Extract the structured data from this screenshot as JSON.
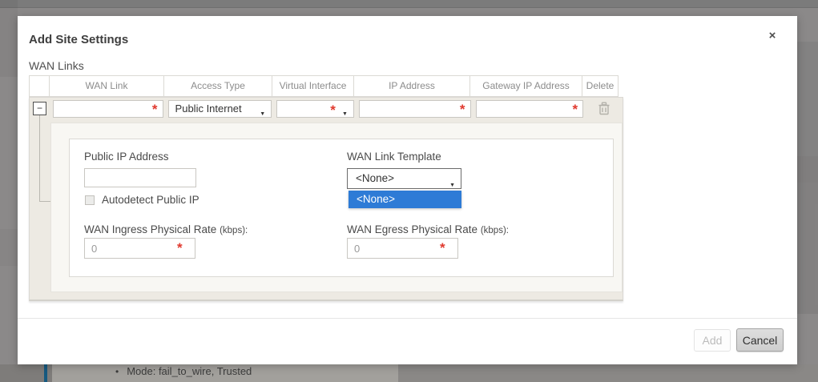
{
  "modal": {
    "title": "Add Site Settings",
    "section_label": "WAN Links",
    "table": {
      "headers": [
        "",
        "WAN Link",
        "Access Type",
        "Virtual Interface",
        "IP Address",
        "Gateway IP Address",
        "Delete"
      ],
      "row": {
        "wan_link_value": "",
        "access_type_value": "Public Internet",
        "virtual_interface_value": "",
        "ip_address_value": "",
        "gateway_ip_value": ""
      }
    },
    "detail_panel": {
      "public_ip_label": "Public IP Address",
      "public_ip_value": "",
      "autodetect_label": "Autodetect Public IP",
      "autodetect_checked": false,
      "template_label": "WAN Link Template",
      "template_selected_value": "<None>",
      "template_open_option": "<None>",
      "ingress_label": "WAN Ingress Physical Rate",
      "ingress_unit": "(kbps):",
      "ingress_value": "0",
      "egress_label": "WAN Egress Physical Rate",
      "egress_unit": "(kbps):",
      "egress_value": "0"
    },
    "footer": {
      "add_label": "Add",
      "cancel_label": "Cancel"
    }
  },
  "background": {
    "mode_text": "Mode: fail_to_wire, Trusted"
  },
  "icons": {
    "close": "×",
    "collapse_minus": "−",
    "caret_down": "▼",
    "required_marker": "*",
    "bullet": "•"
  },
  "colors": {
    "required_red": "#e0392e",
    "option_highlight_blue": "#2e7bd6",
    "row_background": "#edeae3",
    "sidebar_accent_blue": "#175a80"
  }
}
